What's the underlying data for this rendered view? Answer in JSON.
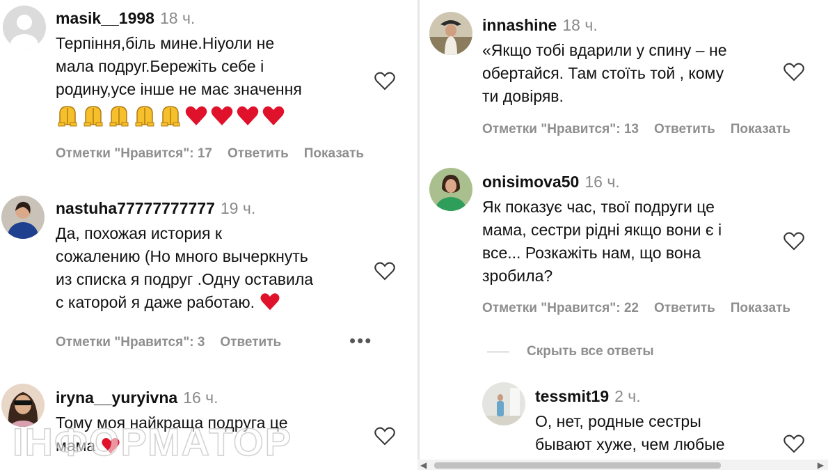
{
  "comments": [
    {
      "username": "masik__1998",
      "time": "18 ч.",
      "lines": [
        "Терпіння,біль мине.Ніуоли не",
        "мала подруг.Бережіть себе і",
        "родину,усе інше не має значення"
      ],
      "emoji": [
        "folded-hands",
        "folded-hands",
        "folded-hands",
        "folded-hands",
        "folded-hands",
        "red-heart",
        "red-heart",
        "red-heart",
        "red-heart"
      ],
      "likes": "Отметки \"Нравится\": 17",
      "reply": "Ответить",
      "show": "Показать"
    },
    {
      "username": "nastuha77777777777",
      "time": "19 ч.",
      "lines": [
        "Да, похожая история к",
        "сожалению (Но много вычеркнуть",
        "из списка я подруг .Одну оставила",
        "с каторой я даже работаю."
      ],
      "likes": "Отметки \"Нравится\": 3",
      "reply": "Ответить",
      "more": "•••"
    },
    {
      "username": "iryna__yuryivna",
      "time": "16 ч.",
      "lines": [
        "Тому моя найкраща подруга це",
        "мама"
      ]
    },
    {
      "username": "innashine",
      "time": "18 ч.",
      "lines": [
        "«Якщо тобі вдарили у спину – не",
        "обертайся. Там стоїть той , кому",
        "ти довіряв."
      ],
      "likes": "Отметки \"Нравится\": 13",
      "reply": "Ответить",
      "show": "Показать"
    },
    {
      "username": "onisimova50",
      "time": "16 ч.",
      "lines": [
        "Як показує час, твої подруги це",
        "мама, сестри рідні якщо вони є і",
        "все... Розкажіть нам, що вона",
        "зробила?"
      ],
      "likes": "Отметки \"Нравится\": 22",
      "reply": "Ответить",
      "show": "Показать"
    },
    {
      "username": "tessmit19",
      "time": "2 ч.",
      "lines": [
        "О, нет, родные сестры",
        "бывают хуже, чем любые"
      ]
    }
  ],
  "hide_replies": "Скрыть все ответы",
  "watermark": "ІНФОРМАТОР",
  "colors": {
    "meta": "#8e8e8e",
    "heart_red": "#e0112b",
    "emoji_yellow": "#f6c02c"
  }
}
